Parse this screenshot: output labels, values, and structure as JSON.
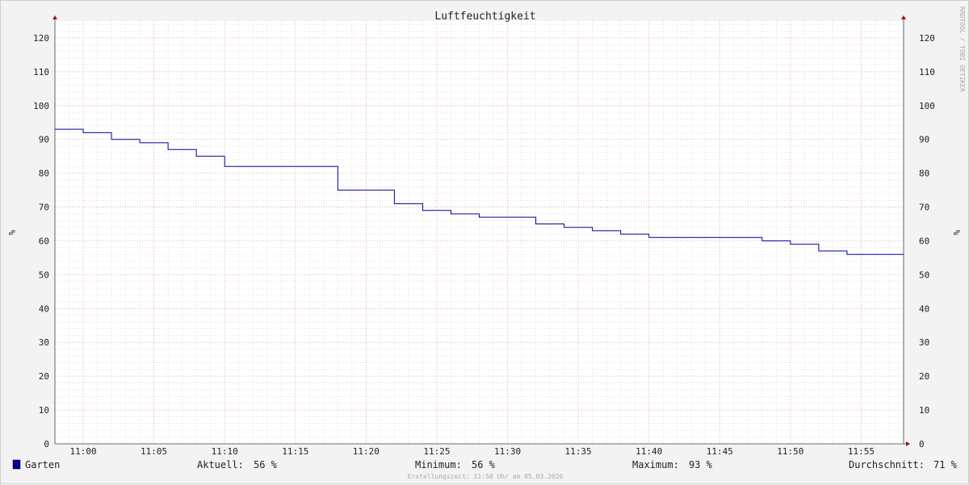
{
  "chart_data": {
    "type": "line",
    "title": "Luftfeuchtigkeit",
    "ylabel": "%",
    "ylabel_right": "%",
    "ylim": [
      0,
      125
    ],
    "yticks": [
      0,
      10,
      20,
      30,
      40,
      50,
      60,
      70,
      80,
      90,
      100,
      110,
      120
    ],
    "xlim": [
      "10:58",
      "11:58"
    ],
    "xticks": [
      "11:00",
      "11:05",
      "11:10",
      "11:15",
      "11:20",
      "11:25",
      "11:30",
      "11:35",
      "11:40",
      "11:45",
      "11:50",
      "11:55"
    ],
    "grid": true,
    "series": [
      {
        "name": "Garten",
        "color": "#000099",
        "step": true,
        "points": [
          [
            "10:58",
            93
          ],
          [
            "11:00",
            92
          ],
          [
            "11:02",
            90
          ],
          [
            "11:04",
            89
          ],
          [
            "11:06",
            87
          ],
          [
            "11:08",
            85
          ],
          [
            "11:10",
            82
          ],
          [
            "11:18",
            75
          ],
          [
            "11:22",
            71
          ],
          [
            "11:24",
            69
          ],
          [
            "11:26",
            68
          ],
          [
            "11:28",
            67
          ],
          [
            "11:32",
            65
          ],
          [
            "11:34",
            64
          ],
          [
            "11:36",
            63
          ],
          [
            "11:38",
            62
          ],
          [
            "11:40",
            61
          ],
          [
            "11:48",
            60
          ],
          [
            "11:50",
            59
          ],
          [
            "11:52",
            57
          ],
          [
            "11:54",
            56
          ],
          [
            "11:58",
            56
          ]
        ]
      }
    ]
  },
  "legend": {
    "series_name": "Garten",
    "series_color": "#000099",
    "current_label": "Aktuell:",
    "current_value": "56 %",
    "min_label": "Minimum:",
    "min_value": "56 %",
    "max_label": "Maximum:",
    "max_value": "93 %",
    "avg_label": "Durchschnitt:",
    "avg_value": "71 %"
  },
  "footer_text": "Erstellungszeit: 11:58 Uhr am 05.03.2026",
  "watermark": "RRDTOOL / TOBI OETIKER",
  "colors": {
    "major_grid": "#e8a0a0",
    "minor_grid": "#d0d0d0",
    "axis": "#666666",
    "arrow": "#aa1111"
  }
}
